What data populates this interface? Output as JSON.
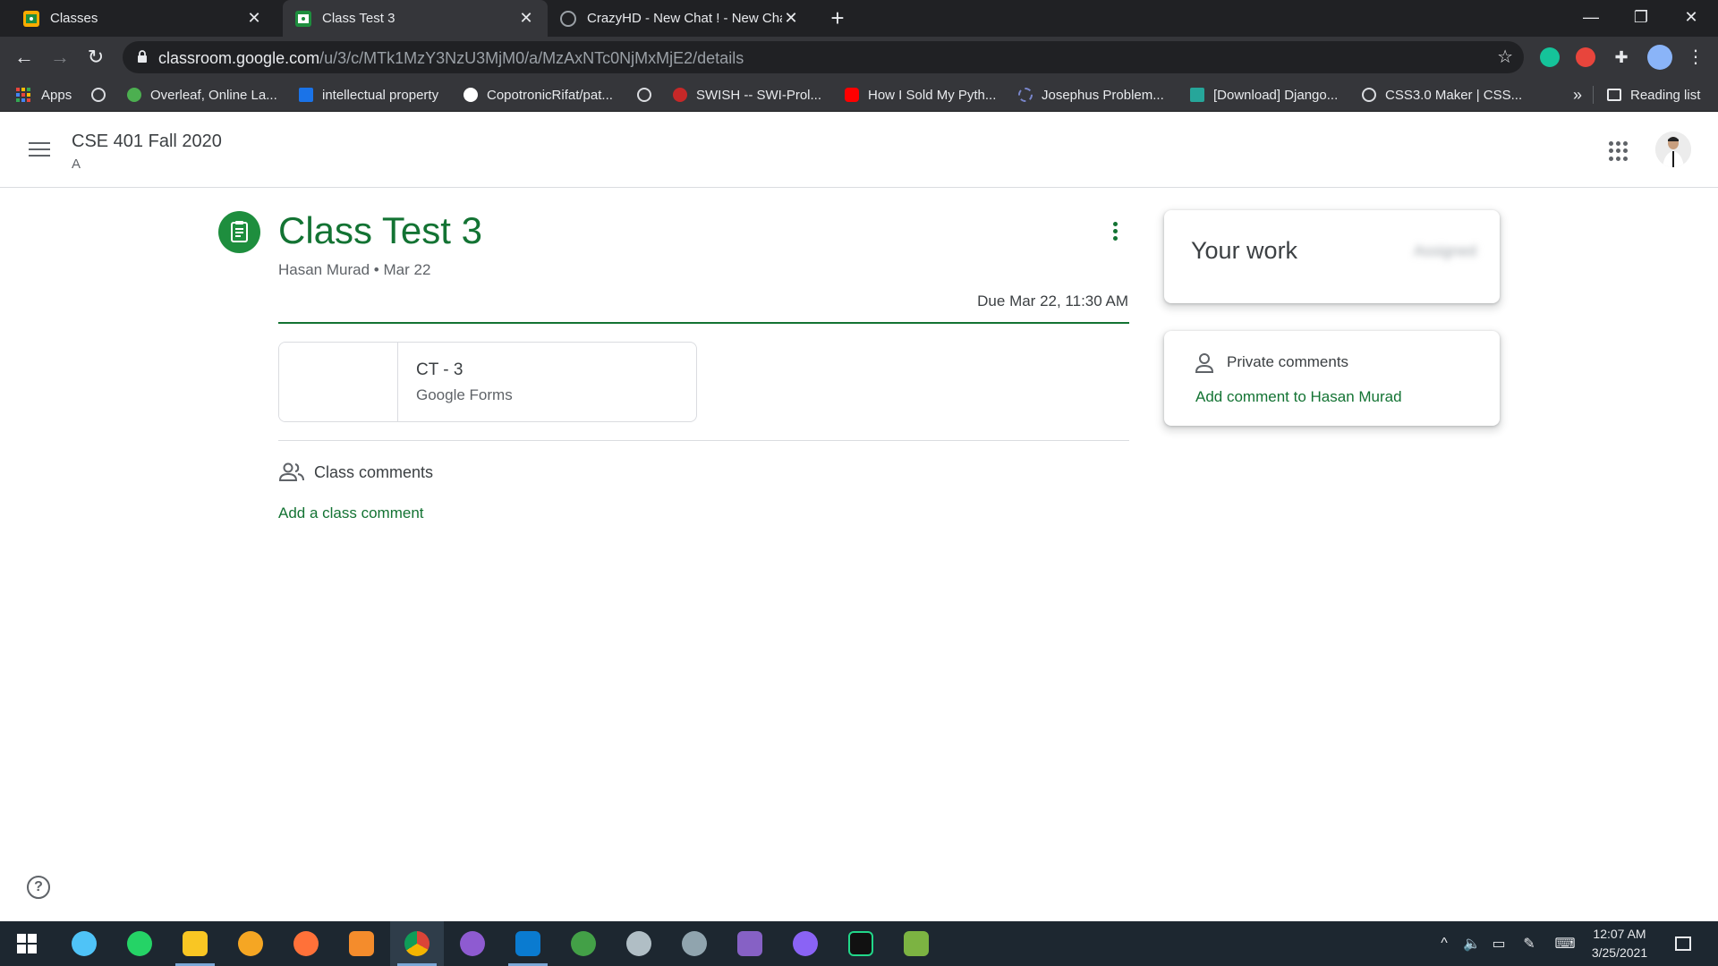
{
  "browser": {
    "tabs": [
      {
        "title": "Classes",
        "fav_color": "#f9ab00"
      },
      {
        "title": "Class Test 3",
        "fav_color": "#1e8e3e"
      },
      {
        "title": "CrazyHD - New Chat ! - New Cha",
        "fav_color": "#9aa0a6"
      }
    ],
    "new_tab": "+",
    "window": {
      "minimize": "—",
      "restore": "❐",
      "close": "✕"
    },
    "url_host": "classroom.google.com",
    "url_path": "/u/3/c/MTk1MzY3NzU3MjM0/a/MzAxNTc0NjMxMjE2/details",
    "bookmarks": [
      {
        "label": "Apps",
        "color": "#e8453c"
      },
      {
        "label": "",
        "color": "#dadce0"
      },
      {
        "label": "Overleaf, Online La...",
        "color": "#4caf50"
      },
      {
        "label": "intellectual property",
        "color": "#1a73e8"
      },
      {
        "label": "CopotronicRifat/pat...",
        "color": "#ffffff"
      },
      {
        "label": "",
        "color": "#dadce0"
      },
      {
        "label": "SWISH -- SWI-Prol...",
        "color": "#c62828"
      },
      {
        "label": "How I Sold My Pyth...",
        "color": "#ff0000"
      },
      {
        "label": "Josephus Problem...",
        "color": "#7986cb"
      },
      {
        "label": "[Download] Django...",
        "color": "#26a69a"
      },
      {
        "label": "CSS3.0 Maker | CSS...",
        "color": "#dadce0"
      }
    ],
    "bookmarks_overflow": "»",
    "reading_list": "Reading list"
  },
  "classroom": {
    "class_title": "CSE 401 Fall 2020",
    "class_section": "A",
    "assignment": {
      "title": "Class Test 3",
      "author": "Hasan Murad",
      "date": "Mar 22",
      "separator": "•",
      "due": "Due Mar 22, 11:30 AM",
      "attachment": {
        "name": "CT - 3",
        "type": "Google Forms"
      }
    },
    "class_comments": {
      "label": "Class comments",
      "add": "Add a class comment"
    },
    "your_work": {
      "title": "Your work",
      "status": "Assigned"
    },
    "private_comments": {
      "label": "Private comments",
      "add": "Add comment to Hasan Murad"
    },
    "help": "?"
  },
  "taskbar": {
    "apps": [
      {
        "name": "start",
        "color": "#ffffff"
      },
      {
        "name": "app-1",
        "color": "#4fc3f7"
      },
      {
        "name": "whatsapp",
        "color": "#25d366"
      },
      {
        "name": "file-explorer",
        "color": "#f9c623"
      },
      {
        "name": "app-4",
        "color": "#f5a623"
      },
      {
        "name": "firefox",
        "color": "#ff7139"
      },
      {
        "name": "app-6",
        "color": "#f48c2c"
      },
      {
        "name": "chrome",
        "color": "#db4437"
      },
      {
        "name": "github-desktop",
        "color": "#8e5bd1"
      },
      {
        "name": "vscode",
        "color": "#0a7bd0"
      },
      {
        "name": "app-10",
        "color": "#43a047"
      },
      {
        "name": "app-11",
        "color": "#b0bec5"
      },
      {
        "name": "app-12",
        "color": "#90a4ae"
      },
      {
        "name": "visual-studio",
        "color": "#8661c5"
      },
      {
        "name": "messenger",
        "color": "#8a63f5"
      },
      {
        "name": "pycharm",
        "color": "#21d789"
      },
      {
        "name": "app-16",
        "color": "#7cb342"
      }
    ],
    "time": "12:07 AM",
    "date": "3/25/2021"
  }
}
